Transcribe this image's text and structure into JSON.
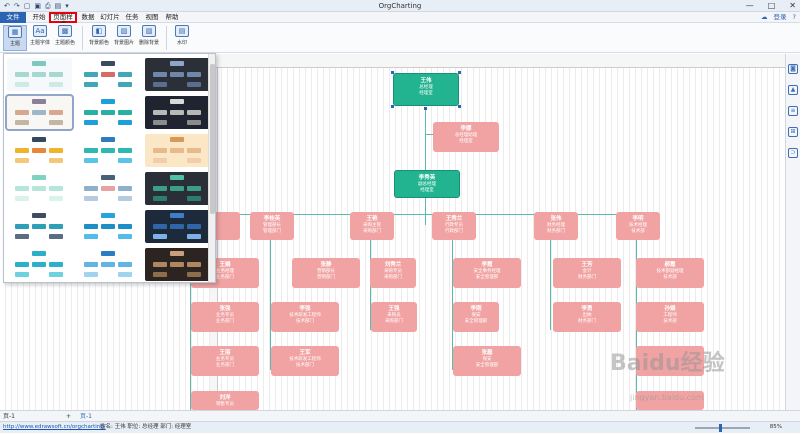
{
  "app": {
    "title": "OrgCharting",
    "window_controls": [
      "—",
      "□",
      "✕"
    ]
  },
  "quick_access": [
    "↶",
    "↷",
    "▢",
    "▣",
    "⎙",
    "▤",
    "▾"
  ],
  "menu": {
    "file": "文件",
    "tabs": [
      "开始",
      "页面样式",
      "数据",
      "幻灯片",
      "任务",
      "视图",
      "帮助"
    ],
    "active": "页面样式",
    "right": [
      "登录",
      "?"
    ]
  },
  "ribbon": {
    "buttons": [
      "主题",
      "主题字体",
      "主题颜色",
      "背景颜色",
      "背景图片",
      "删除背景",
      "水印"
    ]
  },
  "right_icons": [
    "person-card-icon",
    "org-chart-icon",
    "list-icon",
    "hierarchy-icon",
    "connect-icon"
  ],
  "chart": {
    "root": {
      "name": "王伟",
      "title1": "总经理",
      "title2": "经理室"
    },
    "assistant": {
      "name": "李娜",
      "title1": "总经理助理",
      "title2": "经理室"
    },
    "vp": {
      "name": "李秀英",
      "title1": "副总经理",
      "title2": "经理室"
    },
    "managers": [
      {
        "name": "",
        "title1": "",
        "title2": ""
      },
      {
        "name": "李桂英",
        "title1": "管理部长",
        "title2": "管理部门"
      },
      {
        "name": "王艳",
        "title1": "采购主管",
        "title2": "采购部门"
      },
      {
        "name": "王秀兰",
        "title1": "行政专员",
        "title2": "行政部门"
      },
      {
        "name": "张伟",
        "title1": "财务经理",
        "title2": "财务部门"
      },
      {
        "name": "李明",
        "title1": "技术经理",
        "title2": "技术部"
      }
    ],
    "row2": [
      {
        "name": "王娟",
        "title1": "业务经理",
        "title2": "业务部门"
      },
      {
        "name": "张静",
        "title1": "营销部长",
        "title2": "营销部门"
      },
      {
        "name": "刘秀兰",
        "title1": "采购专员",
        "title2": "采购部门"
      },
      {
        "name": "李霞",
        "title1": "安全事务经理",
        "title2": "安全管理部"
      },
      {
        "name": "王芳",
        "title1": "会计",
        "title2": "财务部门"
      },
      {
        "name": "郝霞",
        "title1": "技术部副经理",
        "title2": "技术部"
      }
    ],
    "row3": [
      {
        "name": "张强",
        "title1": "业务专员",
        "title2": "业务部门"
      },
      {
        "name": "李强",
        "title1": "技术研发工程师",
        "title2": "技术部门"
      },
      {
        "name": "王强",
        "title1": "采购员",
        "title2": "采购部门"
      },
      {
        "name": "李刚",
        "title1": "保安",
        "title2": "安全管理部"
      },
      {
        "name": "李勇",
        "title1": "出纳",
        "title2": "财务部门"
      },
      {
        "name": "孙娟",
        "title1": "工程师",
        "title2": "技术部"
      }
    ],
    "row4": [
      {
        "name": "王丽",
        "title1": "业务专员",
        "title2": "业务部门"
      },
      {
        "name": "王军",
        "title1": "技术研发工程师",
        "title2": "技术部门"
      },
      {
        "name": "张磊",
        "title1": "保安",
        "title2": "安全管理部"
      }
    ],
    "row5": [
      {
        "name": "刘洋",
        "title1": "销售专员",
        "title2": ""
      }
    ]
  },
  "pagebar": {
    "page1": "页-1",
    "add": "+",
    "page_tab": "页-1"
  },
  "status": {
    "link": "http://www.edrawsoft.cn/orgcharting/",
    "info": "姓名: 王伟  职位: 总经理  部门: 经理室",
    "zoom": "85%"
  },
  "watermark": {
    "main": "Baidu经验",
    "sub": "jingyan.baidu.com"
  },
  "colors": {
    "accent": "#2c64b2",
    "pink_node": "#f1a3a3",
    "green_node": "#22b491",
    "connector": "#5fb8ac",
    "active_tab_border": "#e8000b"
  }
}
